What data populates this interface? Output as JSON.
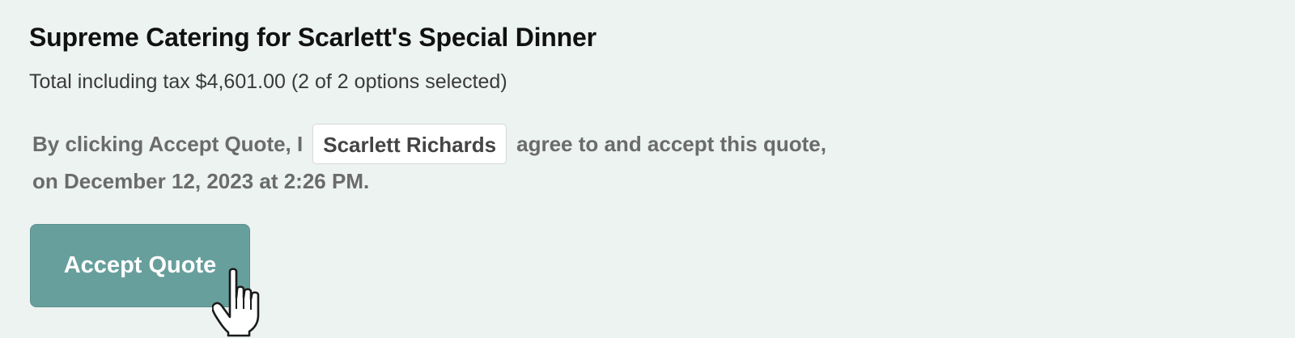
{
  "quote": {
    "title": "Supreme Catering for Scarlett's Special Dinner",
    "summary": "Total including tax $4,601.00 (2 of 2 options selected)"
  },
  "agreement": {
    "prefix": "By clicking Accept Quote, I",
    "signer_name": "Scarlett Richards",
    "suffix": "agree to and accept this quote,",
    "date_line": "on December 12, 2023 at 2:26 PM."
  },
  "actions": {
    "accept_label": "Accept Quote"
  },
  "cursor": {
    "icon": "hand-pointer-icon"
  },
  "colors": {
    "background": "#ecf3f0",
    "accent": "#679f9c"
  }
}
